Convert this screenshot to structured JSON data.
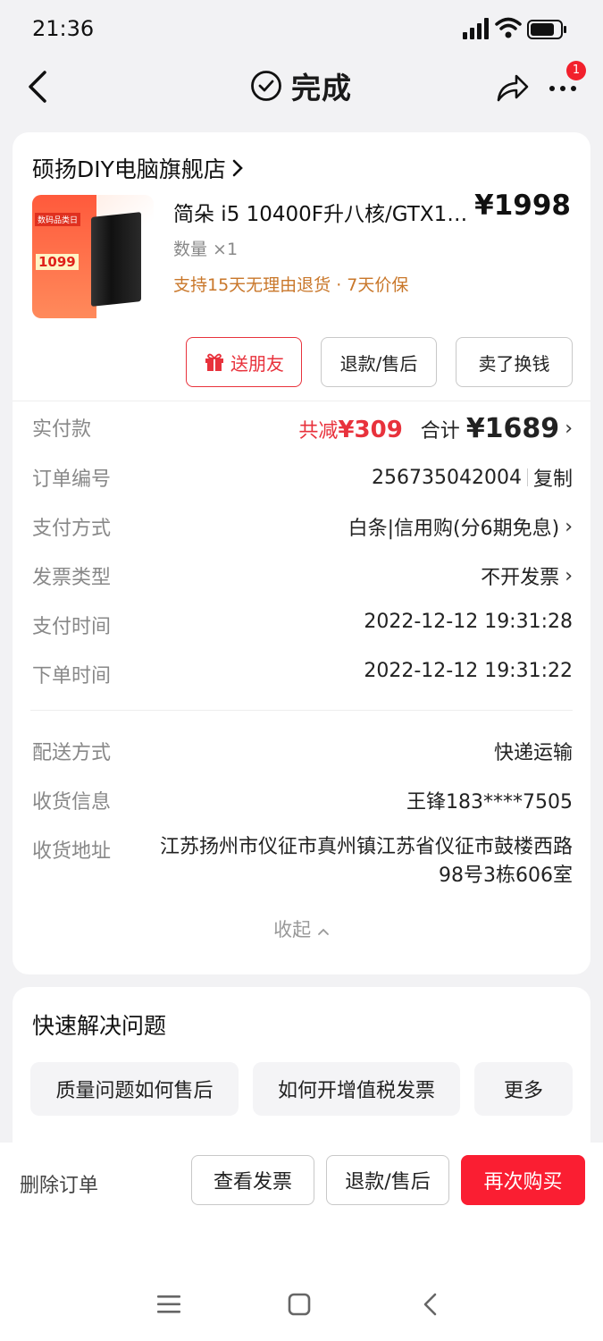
{
  "status_bar": {
    "time": "21:36"
  },
  "nav": {
    "title": "完成",
    "badge_count": "1"
  },
  "order": {
    "shop_name": "硕扬DIY电脑旗舰店",
    "product": {
      "title": "简朵 i5 10400F升八核/GTX1…",
      "price": "¥1998",
      "qty_label": "数量 ×1",
      "service": "支持15天无理由退货 · 7天价保",
      "promo_tag": "数码品类日",
      "promo_price": "1099"
    },
    "actions": {
      "gift": "送朋友",
      "refund": "退款/售后",
      "sell": "卖了换钱"
    },
    "payment": {
      "label": "实付款",
      "save_prefix": "共减",
      "save_amount": "¥309",
      "total_prefix": "合计",
      "total_amount": "¥1689"
    },
    "details": [
      {
        "k": "订单编号",
        "v": "256735042004",
        "extra": "复制"
      },
      {
        "k": "支付方式",
        "v": "白条|信用购(分6期免息)"
      },
      {
        "k": "发票类型",
        "v": "不开发票"
      },
      {
        "k": "支付时间",
        "v": "2022-12-12 19:31:28"
      },
      {
        "k": "下单时间",
        "v": "2022-12-12 19:31:22"
      }
    ],
    "delivery": [
      {
        "k": "配送方式",
        "v": "快递运输"
      },
      {
        "k": "收货信息",
        "v": "王锋183****7505"
      },
      {
        "k": "收货地址",
        "v": "江苏扬州市仪征市真州镇江苏省仪征市鼓楼西路98号3栋606室"
      }
    ],
    "collapse_label": "收起"
  },
  "quick_help": {
    "title": "快速解决问题",
    "chips": [
      "质量问题如何售后",
      "如何开增值税发票",
      "更多"
    ]
  },
  "bottom_bar": {
    "delete": "删除订单",
    "invoice": "查看发票",
    "refund": "退款/售后",
    "rebuy": "再次购买"
  },
  "colors": {
    "accent": "#fa1e32",
    "service": "#c9772a"
  }
}
